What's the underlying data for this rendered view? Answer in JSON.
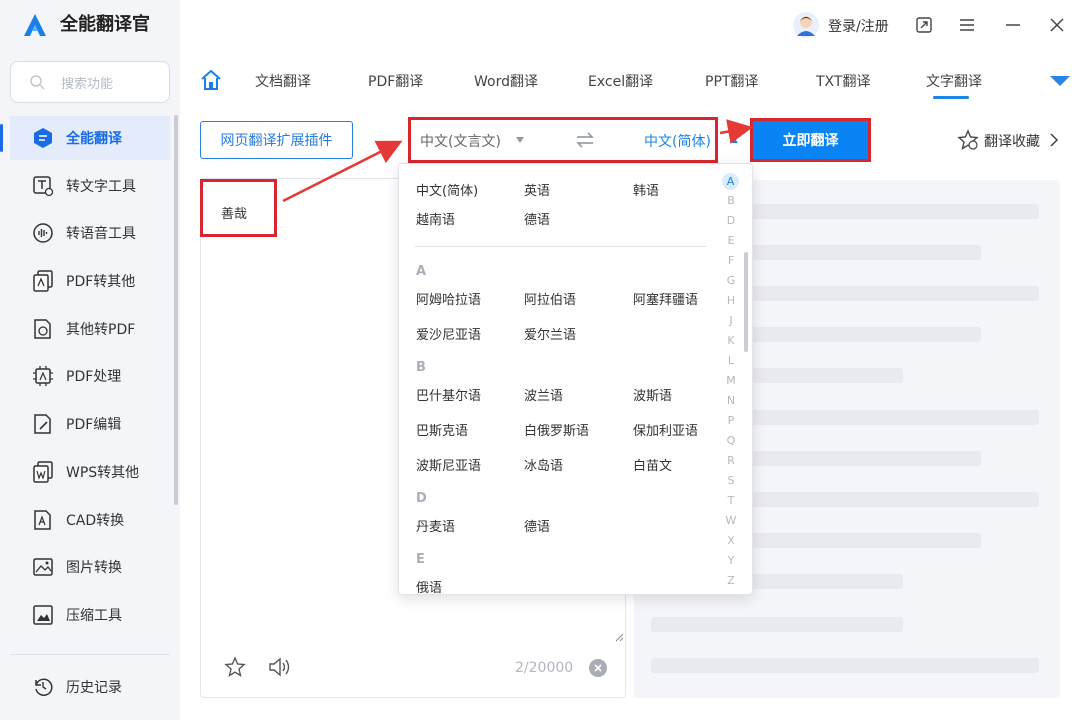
{
  "app": {
    "title": "全能翻译官"
  },
  "sidebar": {
    "search_placeholder": "搜索功能",
    "items": [
      {
        "label": "全能翻译",
        "icon": "translate-icon",
        "active": true
      },
      {
        "label": "转文字工具",
        "icon": "text-convert-icon"
      },
      {
        "label": "转语音工具",
        "icon": "voice-icon"
      },
      {
        "label": "PDF转其他",
        "icon": "pdf-export-icon"
      },
      {
        "label": "其他转PDF",
        "icon": "pdf-import-icon"
      },
      {
        "label": "PDF处理",
        "icon": "pdf-process-icon"
      },
      {
        "label": "PDF编辑",
        "icon": "pdf-edit-icon"
      },
      {
        "label": "WPS转其他",
        "icon": "wps-icon"
      },
      {
        "label": "CAD转换",
        "icon": "cad-icon"
      },
      {
        "label": "图片转换",
        "icon": "image-icon"
      },
      {
        "label": "压缩工具",
        "icon": "compress-icon"
      }
    ],
    "history": "历史记录"
  },
  "topbar": {
    "login": "登录/注册"
  },
  "tabs": [
    "文档翻译",
    "PDF翻译",
    "Word翻译",
    "Excel翻译",
    "PPT翻译",
    "TXT翻译",
    "文字翻译"
  ],
  "toolbar": {
    "extension_button": "网页翻译扩展插件",
    "source_lang": "中文(文言文)",
    "target_lang": "中文(简体)",
    "translate_button": "立即翻译",
    "favorites": "翻译收藏"
  },
  "source": {
    "text": "善哉",
    "count": "2/20000"
  },
  "dropdown": {
    "common": [
      "中文(简体)",
      "英语",
      "韩语",
      "越南语",
      "德语"
    ],
    "groups": [
      {
        "letter": "A",
        "langs": [
          "阿姆哈拉语",
          "阿拉伯语",
          "阿塞拜疆语",
          "爱沙尼亚语",
          "爱尔兰语"
        ]
      },
      {
        "letter": "B",
        "langs": [
          "巴什基尔语",
          "波兰语",
          "波斯语",
          "巴斯克语",
          "白俄罗斯语",
          "保加利亚语",
          "波斯尼亚语",
          "冰岛语",
          "白苗文"
        ]
      },
      {
        "letter": "D",
        "langs": [
          "丹麦语",
          "德语"
        ]
      },
      {
        "letter": "E",
        "langs": [
          "俄语"
        ]
      }
    ],
    "index": [
      "A",
      "B",
      "D",
      "E",
      "F",
      "G",
      "H",
      "J",
      "K",
      "L",
      "M",
      "N",
      "P",
      "Q",
      "R",
      "S",
      "T",
      "W",
      "X",
      "Y",
      "Z"
    ]
  },
  "colors": {
    "accent": "#0a84f5",
    "highlight": "#d7262e",
    "sidebar_bg": "#f3f5f9"
  }
}
